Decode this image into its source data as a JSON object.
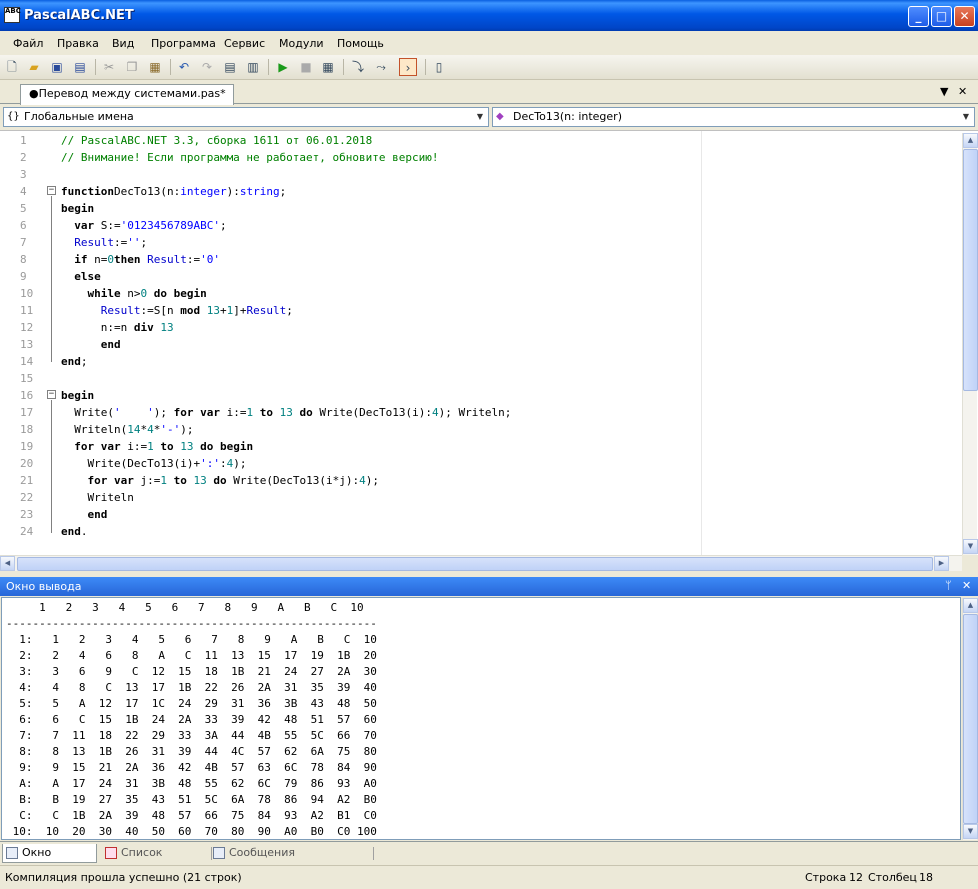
{
  "window": {
    "title": "PascalABC.NET",
    "icon_text": "ABC"
  },
  "menu": [
    "Файл",
    "Правка",
    "Вид",
    "Программа",
    "Сервис",
    "Модули",
    "Помощь"
  ],
  "toolbar_icons": [
    "new-file-icon",
    "open-icon",
    "save-icon",
    "save-all-icon",
    "cut-icon",
    "copy-icon",
    "paste-icon",
    "undo-icon",
    "redo-icon",
    "comment-icon",
    "uncomment-icon",
    "run-icon",
    "stop-icon",
    "compile-icon",
    "step-into-icon",
    "step-over-icon",
    "output-window-icon",
    "module-icon"
  ],
  "document_tab": {
    "label": "●Перевод между системами.pas*"
  },
  "nav": {
    "left": "Глобальные имена",
    "right": "DecTo13(n: integer)"
  },
  "editor": {
    "line_numbers": [
      "1",
      "2",
      "3",
      "4",
      "5",
      "6",
      "7",
      "8",
      "9",
      "10",
      "11",
      "12",
      "13",
      "14",
      "15",
      "16",
      "17",
      "18",
      "19",
      "20",
      "21",
      "22",
      "23",
      "24"
    ]
  },
  "code_lines": [
    [
      [
        "cm",
        "// PascalABC.NET 3.3, сборка 1611 от 06.01.2018"
      ]
    ],
    [
      [
        "cm",
        "// Внимание! Если программа не работает, обновите версию!"
      ]
    ],
    [],
    [
      [
        "kw",
        "function"
      ],
      [
        "",
        "DecTo13(n:"
      ],
      [
        "ty",
        "integer"
      ],
      [
        "",
        "):"
      ],
      [
        "ty",
        "string"
      ],
      [
        "",
        ";"
      ]
    ],
    [
      [
        "kw",
        "begin"
      ]
    ],
    [
      [
        "",
        "  "
      ],
      [
        "kw",
        "var"
      ],
      [
        "",
        " S:="
      ],
      [
        "st",
        "'0123456789ABC'"
      ],
      [
        "",
        ";"
      ]
    ],
    [
      [
        "",
        "  "
      ],
      [
        "id",
        "Result"
      ],
      [
        "",
        ":="
      ],
      [
        "st",
        "''"
      ],
      [
        "",
        ";"
      ]
    ],
    [
      [
        "",
        "  "
      ],
      [
        "kw",
        "if"
      ],
      [
        "",
        " n="
      ],
      [
        "nm",
        "0"
      ],
      [
        "",
        "",
        " "
      ],
      [
        "kw",
        "then"
      ],
      [
        "",
        " "
      ],
      [
        "id",
        "Result"
      ],
      [
        "",
        ":="
      ],
      [
        "st",
        "'0'"
      ]
    ],
    [
      [
        "",
        "  "
      ],
      [
        "kw",
        "else"
      ]
    ],
    [
      [
        "",
        "    "
      ],
      [
        "kw",
        "while"
      ],
      [
        "",
        " n>"
      ],
      [
        "nm",
        "0"
      ],
      [
        "",
        " "
      ],
      [
        "kw",
        "do"
      ],
      [
        "",
        " "
      ],
      [
        "kw",
        "begin"
      ]
    ],
    [
      [
        "",
        "      "
      ],
      [
        "id",
        "Result"
      ],
      [
        "",
        ":=S[n "
      ],
      [
        "kw",
        "mod"
      ],
      [
        "",
        " "
      ],
      [
        "nm",
        "13"
      ],
      [
        "",
        "+"
      ],
      [
        "nm",
        "1"
      ],
      [
        "",
        "]+"
      ],
      [
        "id",
        "Result"
      ],
      [
        "",
        ";"
      ]
    ],
    [
      [
        "",
        "      n:=n "
      ],
      [
        "kw",
        "div"
      ],
      [
        "",
        " "
      ],
      [
        "nm",
        "13"
      ]
    ],
    [
      [
        "",
        "      "
      ],
      [
        "kw",
        "end"
      ]
    ],
    [
      [
        "kw",
        "end"
      ],
      [
        "",
        ";"
      ]
    ],
    [],
    [
      [
        "kw",
        "begin"
      ]
    ],
    [
      [
        "",
        "  Write("
      ],
      [
        "st",
        "'    '"
      ],
      [
        "",
        "); "
      ],
      [
        "kw",
        "for"
      ],
      [
        "",
        " "
      ],
      [
        "kw",
        "var"
      ],
      [
        "",
        " i:="
      ],
      [
        "nm",
        "1"
      ],
      [
        "",
        " "
      ],
      [
        "kw",
        "to"
      ],
      [
        "",
        " "
      ],
      [
        "nm",
        "13"
      ],
      [
        "",
        " "
      ],
      [
        "kw",
        "do"
      ],
      [
        "",
        " Write(DecTo13(i):"
      ],
      [
        "nm",
        "4"
      ],
      [
        "",
        "); Writeln;"
      ]
    ],
    [
      [
        "",
        "  Writeln("
      ],
      [
        "nm",
        "14"
      ],
      [
        "",
        "*"
      ],
      [
        "nm",
        "4"
      ],
      [
        "",
        "*"
      ],
      [
        "st",
        "'-'"
      ],
      [
        "",
        ");"
      ]
    ],
    [
      [
        "",
        "  "
      ],
      [
        "kw",
        "for"
      ],
      [
        "",
        " "
      ],
      [
        "kw",
        "var"
      ],
      [
        "",
        " i:="
      ],
      [
        "nm",
        "1"
      ],
      [
        "",
        " "
      ],
      [
        "kw",
        "to"
      ],
      [
        "",
        " "
      ],
      [
        "nm",
        "13"
      ],
      [
        "",
        " "
      ],
      [
        "kw",
        "do"
      ],
      [
        "",
        " "
      ],
      [
        "kw",
        "begin"
      ]
    ],
    [
      [
        "",
        "    Write(DecTo13(i)+"
      ],
      [
        "st",
        "':'"
      ],
      [
        "",
        ":"
      ],
      [
        "nm",
        "4"
      ],
      [
        "",
        ");"
      ]
    ],
    [
      [
        "",
        "    "
      ],
      [
        "kw",
        "for"
      ],
      [
        "",
        " "
      ],
      [
        "kw",
        "var"
      ],
      [
        "",
        " j:="
      ],
      [
        "nm",
        "1"
      ],
      [
        "",
        " "
      ],
      [
        "kw",
        "to"
      ],
      [
        "",
        " "
      ],
      [
        "nm",
        "13"
      ],
      [
        "",
        " "
      ],
      [
        "kw",
        "do"
      ],
      [
        "",
        " Write(DecTo13(i*j):"
      ],
      [
        "nm",
        "4"
      ],
      [
        "",
        ");"
      ]
    ],
    [
      [
        "",
        "    Writeln"
      ]
    ],
    [
      [
        "",
        "    "
      ],
      [
        "kw",
        "end"
      ]
    ],
    [
      [
        "kw",
        "end"
      ],
      [
        "",
        "."
      ]
    ]
  ],
  "output_panel": {
    "title": "Окно вывода",
    "lines": [
      "     1   2   3   4   5   6   7   8   9   A   B   C  10",
      "--------------------------------------------------------",
      "  1:   1   2   3   4   5   6   7   8   9   A   B   C  10",
      "  2:   2   4   6   8   A   C  11  13  15  17  19  1B  20",
      "  3:   3   6   9   C  12  15  18  1B  21  24  27  2A  30",
      "  4:   4   8   C  13  17  1B  22  26  2A  31  35  39  40",
      "  5:   5   A  12  17  1C  24  29  31  36  3B  43  48  50",
      "  6:   6   C  15  1B  24  2A  33  39  42  48  51  57  60",
      "  7:   7  11  18  22  29  33  3A  44  4B  55  5C  66  70",
      "  8:   8  13  1B  26  31  39  44  4C  57  62  6A  75  80",
      "  9:   9  15  21  2A  36  42  4B  57  63  6C  78  84  90",
      "  A:   A  17  24  31  3B  48  55  62  6C  79  86  93  A0",
      "  B:   B  19  27  35  43  51  5C  6A  78  86  94  A2  B0",
      "  C:   C  1B  2A  39  48  57  66  75  84  93  A2  B1  C0",
      " 10:  10  20  30  40  50  60  70  80  90  A0  B0  C0 100"
    ]
  },
  "bottom_tabs": [
    "Окно вывода",
    "Список ошибок",
    "Сообщения компилятора"
  ],
  "status": {
    "message": "Компиляция прошла успешно (21 строк)",
    "row_label": "Строка",
    "row": "12",
    "col_label": "Столбец",
    "col": "18"
  }
}
